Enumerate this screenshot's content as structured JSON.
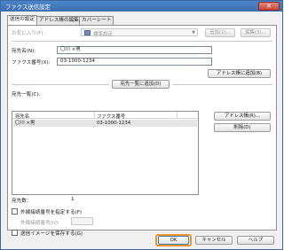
{
  "window": {
    "title": "ファクス送信設定",
    "close_glyph": "✕"
  },
  "tabs": [
    {
      "label": "送信の設定",
      "active": true
    },
    {
      "label": "アドレス帳の編集",
      "active": false
    },
    {
      "label": "カバーシート",
      "active": false
    }
  ],
  "favorites": {
    "label": "お気に入り(F):",
    "value": "標準設定",
    "add_label": "追加(1)...",
    "edit_label": "編集(3)..."
  },
  "recipient": {
    "name_label": "宛先名(N):",
    "name_value": "〇川 ×男",
    "fax_label": "ファクス番号(X):",
    "fax_value": "03-1000-1234",
    "add_to_addressbook_label": "アドレス帳に追加(B)",
    "add_to_list_label": "宛先一覧に追加(D)"
  },
  "recipient_list": {
    "label": "宛先一覧(C):",
    "columns": [
      "宛先名",
      "ファクス番号"
    ],
    "rows": [
      {
        "name": "〇川 ×男",
        "fax": "03-1000-1234"
      }
    ],
    "addressbook_button": "アドレス帳(R)...",
    "delete_button": "削除(D)"
  },
  "recipient_count": {
    "label": "宛先数：",
    "value": "1"
  },
  "outside_line": {
    "checkbox_label": "外線接続番号を指定する(F)",
    "number_label": "外線接続番号(U):",
    "number_value": ""
  },
  "save_image": {
    "checkbox_label": "送信イメージを保存する(G)"
  },
  "footer": {
    "ok_label": "OK",
    "cancel_label": "キャンセル",
    "help_label": "ヘルプ"
  },
  "colors": {
    "titlebar": "#3b6fb0",
    "selection_row": "#e6e6e6",
    "focus_highlight": "#f0932b"
  }
}
